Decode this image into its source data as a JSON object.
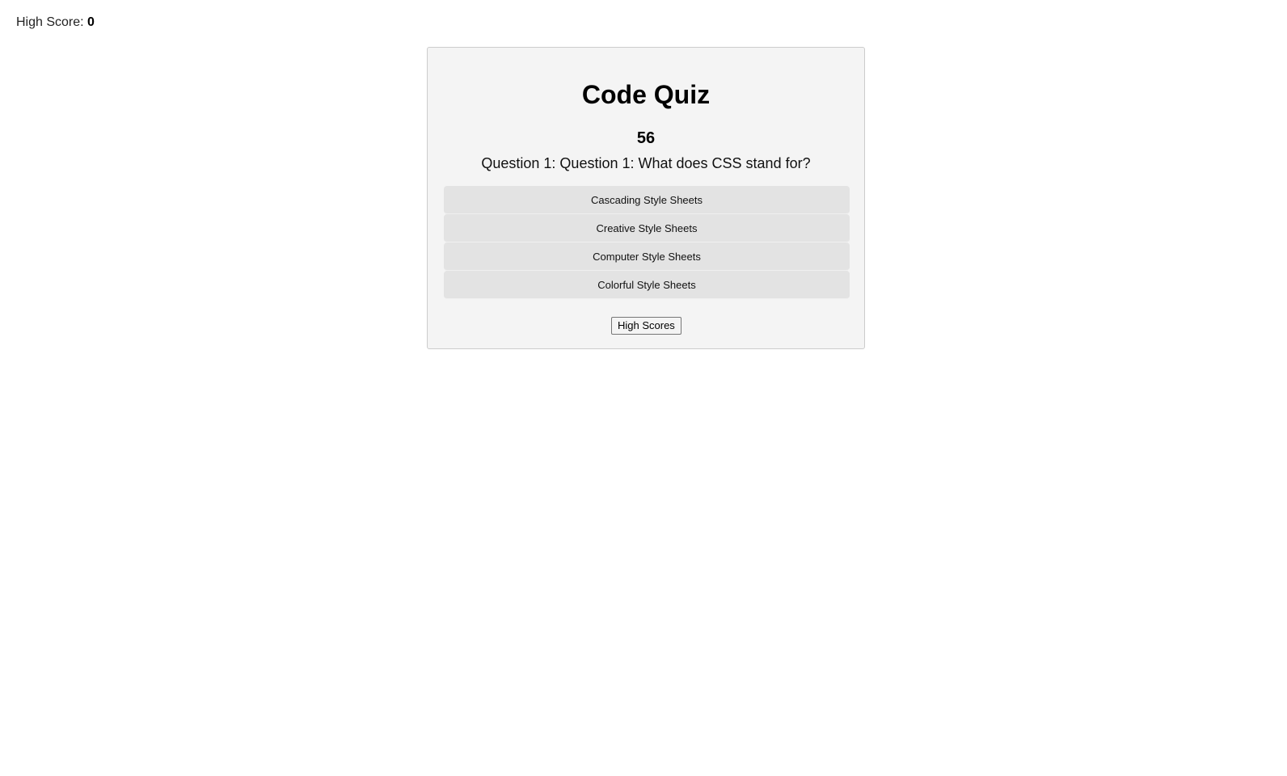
{
  "header": {
    "high_score_label": "High Score:",
    "high_score_value": "0"
  },
  "quiz": {
    "title": "Code Quiz",
    "timer": "56",
    "question": "Question 1: Question 1: What does CSS stand for?",
    "choices": [
      {
        "label": "Cascading Style Sheets"
      },
      {
        "label": "Creative Style Sheets"
      },
      {
        "label": "Computer Style Sheets"
      },
      {
        "label": "Colorful Style Sheets"
      }
    ],
    "high_scores_button": "High Scores"
  },
  "colors": {
    "card_background": "#f4f4f4",
    "choice_background": "#e3e3e3",
    "page_background": "#ffffff"
  }
}
